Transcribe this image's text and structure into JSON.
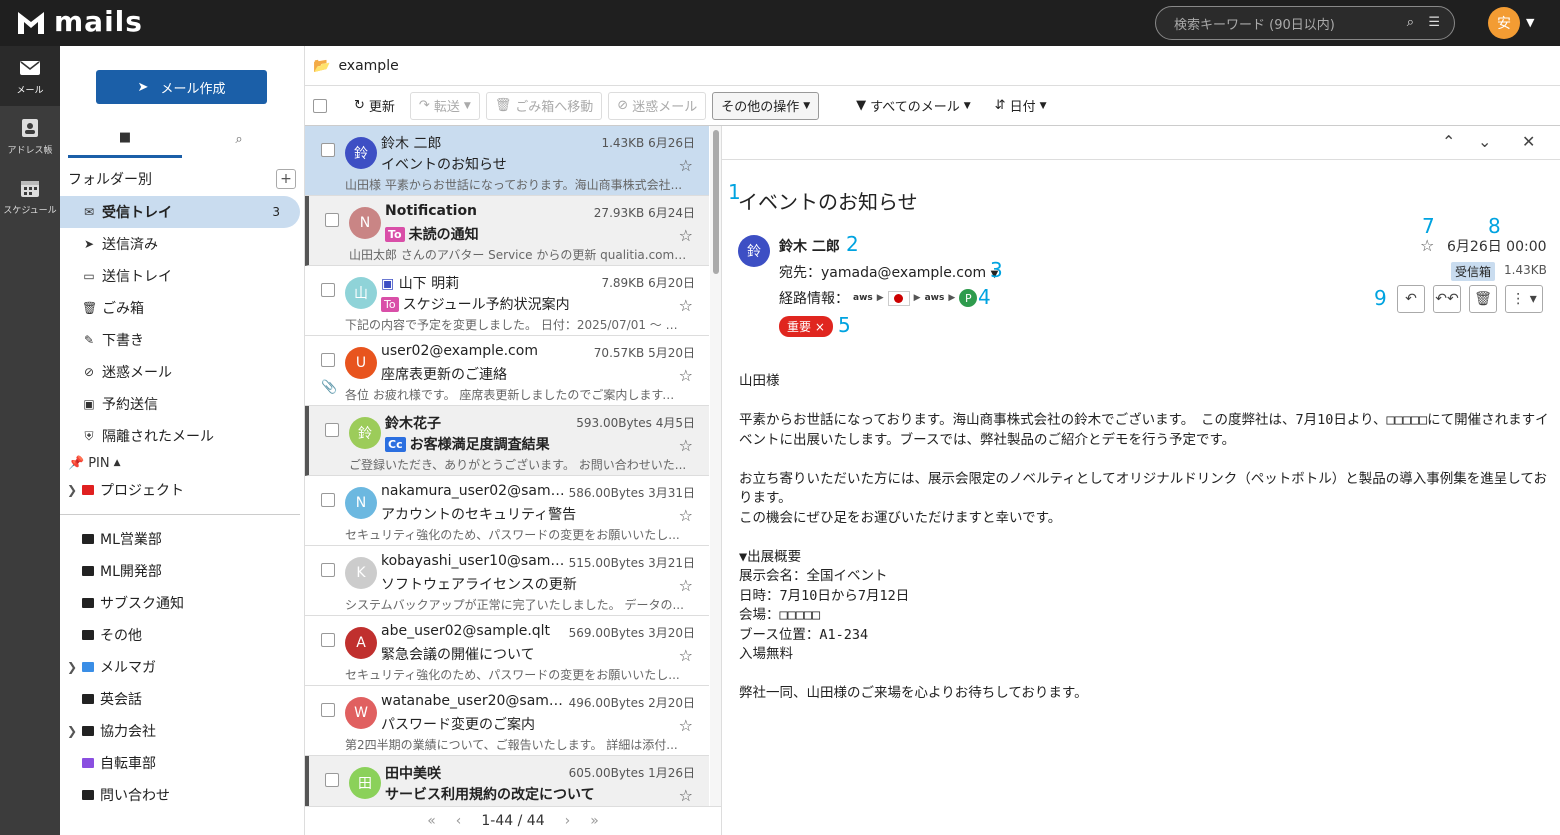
{
  "app": {
    "name": "mails"
  },
  "search": {
    "placeholder": "検索キーワード (90日以内)"
  },
  "user": {
    "avatar": "安"
  },
  "rail": [
    {
      "label": "メール"
    },
    {
      "label": "アドレス帳"
    },
    {
      "label": "スケジュール"
    }
  ],
  "sidebar": {
    "compose": "メール作成",
    "folder_head": "フォルダー別",
    "folders": [
      {
        "label": "受信トレイ",
        "count": "3"
      },
      {
        "label": "送信済み"
      },
      {
        "label": "送信トレイ"
      },
      {
        "label": "ごみ箱"
      },
      {
        "label": "下書き"
      },
      {
        "label": "迷惑メール"
      },
      {
        "label": "予約送信"
      },
      {
        "label": "隔離されたメール"
      }
    ],
    "pin_label": "PIN",
    "pinned": [
      {
        "label": "プロジェクト",
        "color": "#e02020"
      }
    ],
    "others": [
      {
        "label": "ML営業部",
        "color": "#222222"
      },
      {
        "label": "ML開発部",
        "color": "#222222"
      },
      {
        "label": "サブスク通知",
        "color": "#222222"
      },
      {
        "label": "その他",
        "color": "#222222"
      },
      {
        "label": "メルマガ",
        "color": "#3a8ee6"
      },
      {
        "label": "英会話",
        "color": "#222222"
      },
      {
        "label": "協力会社",
        "color": "#222222"
      },
      {
        "label": "自転車部",
        "color": "#8a4fe0"
      },
      {
        "label": "問い合わせ",
        "color": "#222222"
      }
    ]
  },
  "main": {
    "folder": "example"
  },
  "toolbar": {
    "refresh": "更新",
    "forward": "転送",
    "trash": "ごみ箱へ移動",
    "spam": "迷惑メール",
    "more": "その他の操作",
    "filter": "すべてのメール",
    "sort": "日付"
  },
  "mails": [
    {
      "from": "鈴木 二郎",
      "size": "1.43KB",
      "date": "6月26日",
      "subject": "イベントのお知らせ",
      "preview": "山田様 平素からお世話になっております。海山商事株式会社...",
      "avatar": "鈴",
      "color": "#3d4fc4"
    },
    {
      "from": "Notification",
      "size": "27.93KB",
      "date": "6月24日",
      "tag": "To",
      "subject": "未読の通知",
      "preview": "山田太郎 さんのアバター Service からの更新 qualitia.com A...",
      "avatar": "N",
      "color": "#c98585"
    },
    {
      "from": "山下 明莉",
      "size": "7.89KB",
      "date": "6月20日",
      "tag": "To",
      "subject": "スケジュール予約状況案内",
      "preview": "下記の内容で予定を変更しました。 日付：2025/07/01 ～ 20...",
      "avatar": "山",
      "color": "#8fd3d8"
    },
    {
      "from": "user02@example.com",
      "size": "70.57KB",
      "date": "5月20日",
      "subject": "座席表更新のご連絡",
      "preview": "各位 お疲れ様です。 座席表更新しましたのでご案内します。...",
      "avatar": "U",
      "color": "#e8541e"
    },
    {
      "from": "鈴木花子",
      "size": "593.00Bytes",
      "date": "4月5日",
      "tag": "Cc",
      "subject": "お客様満足度調査結果",
      "preview": "ご登録いただき、ありがとうございます。 お問い合わせいた...",
      "avatar": "鈴",
      "color": "#9ccc5a"
    },
    {
      "from": "nakamura_user02@sampl...",
      "size": "586.00Bytes",
      "date": "3月31日",
      "subject": "アカウントのセキュリティ警告",
      "preview": "セキュリティ強化のため、パスワードの変更をお願いいたし...",
      "avatar": "N",
      "color": "#6cb8e0"
    },
    {
      "from": "kobayashi_user10@sample...",
      "size": "515.00Bytes",
      "date": "3月21日",
      "subject": "ソフトウェアライセンスの更新",
      "preview": "システムバックアップが正常に完了いたしました。 データの...",
      "avatar": "K",
      "color": "#cccccc"
    },
    {
      "from": "abe_user02@sample.qlt",
      "size": "569.00Bytes",
      "date": "3月20日",
      "subject": "緊急会議の開催について",
      "preview": "セキュリティ強化のため、パスワードの変更をお願いいたし...",
      "avatar": "A",
      "color": "#c0302e"
    },
    {
      "from": "watanabe_user20@sampl...",
      "size": "496.00Bytes",
      "date": "2月20日",
      "subject": "パスワード変更のご案内",
      "preview": "第2四半期の業績について、ご報告いたします。 詳細は添付...",
      "avatar": "W",
      "color": "#e06060"
    },
    {
      "from": "田中美咲",
      "size": "605.00Bytes",
      "date": "1月26日",
      "subject": "サービス利用規約の改定について",
      "preview": "",
      "avatar": "田",
      "color": "#8bd15a"
    }
  ],
  "pager": {
    "text": "1-44 / 44"
  },
  "detail": {
    "subject": "イベントのお知らせ",
    "from": "鈴木 二郎",
    "avatar": "鈴",
    "to": "宛先：yamada@example.com",
    "route_label": "経路情報：",
    "route_aws": "aws",
    "route_p": "P",
    "label": "重要 ×",
    "date": "6月26日 00:00",
    "box": "受信箱",
    "size": "1.43KB",
    "body": "山田様\n\n平素からお世話になっております。海山商事株式会社の鈴木でございます。　この度弊社は、7月10日より、□□□□□にて開催されますイベントに出展いたします。ブースでは、弊社製品のご紹介とデモを行う予定です。\n\nお立ち寄りいただいた方には、展示会限定のノベルティとしてオリジナルドリンク（ペットボトル）と製品の導入事例集を進呈しております。\nこの機会にぜひ足をお運びいただけますと幸いです。\n\n▼出展概要\n展示会名：全国イベント\n日時：7月10日から7月12日\n会場：□□□□□\nブース位置：A1-234\n入場無料\n\n弊社一同、山田様のご来場を心よりお待ちしております。"
  },
  "markers": [
    "1",
    "2",
    "3",
    "4",
    "5",
    "7",
    "8",
    "9"
  ]
}
